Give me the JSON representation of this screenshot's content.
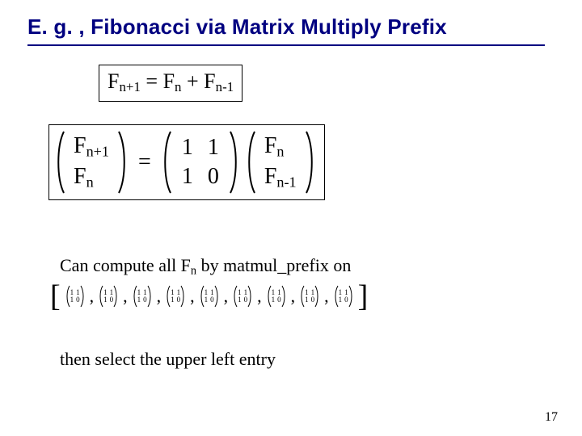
{
  "title": "E. g. , Fibonacci via Matrix Multiply Prefix",
  "recurrence": {
    "lhs_base": "F",
    "lhs_sub": "n+1",
    "eq": " = ",
    "t1_base": "F",
    "t1_sub": "n",
    "plus": "  + ",
    "t2_base": "F",
    "t2_sub": "n-1"
  },
  "matrix_eq": {
    "lhs": {
      "r1": "F",
      "r1_sub": "n+1",
      "r2": "F",
      "r2_sub": "n"
    },
    "eq": "=",
    "mid": {
      "r1c1": "1",
      "r1c2": "1",
      "r2c1": "1",
      "r2c2": "0"
    },
    "rhs": {
      "r1": "F",
      "r1_sub": "n",
      "r2": "F",
      "r2_sub": "n-1"
    }
  },
  "body": {
    "line1_pre": "Can compute all F",
    "line1_sub": "n",
    "line1_post": " by matmul_prefix on",
    "line3": "then select the upper left entry"
  },
  "seq_brackets": {
    "open": "[",
    "close": "]",
    "comma": ","
  },
  "mini_matrix": {
    "a": "1",
    "b": "1",
    "c": "1",
    "d": "0"
  },
  "page_number": "17"
}
